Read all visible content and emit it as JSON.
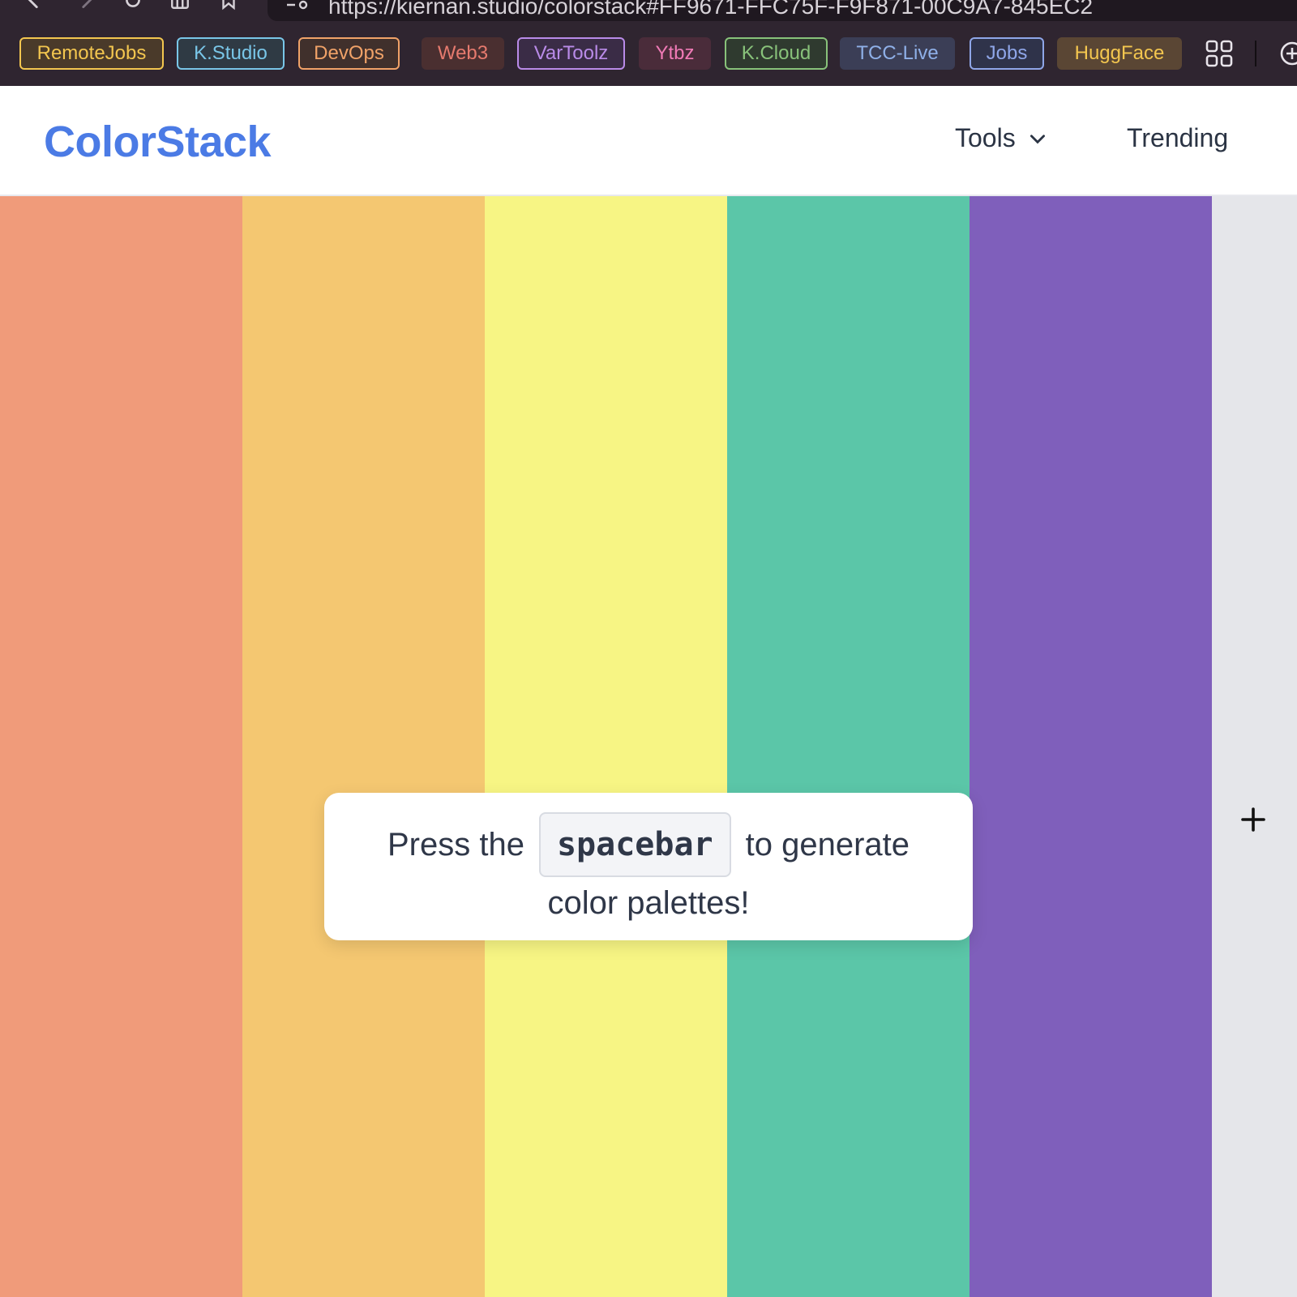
{
  "browser": {
    "url": "https://kiernan.studio/colorstack#FF9671-FFC75F-F9F871-00C9A7-845EC2",
    "bookmarks": [
      {
        "label": "RemoteJobs",
        "color": "#f3c64f",
        "bg": "#4a3a2a"
      },
      {
        "label": "K.Studio",
        "color": "#79c6e8",
        "bg": "#2f3a44"
      },
      {
        "label": "DevOps",
        "color": "#f0a268",
        "bg": "#40302c"
      },
      {
        "label": "Web3",
        "color": "#e57a6e",
        "bg": "#4a2f30"
      },
      {
        "label": "VarToolz",
        "color": "#b98be8",
        "bg": "#3a2c46"
      },
      {
        "label": "Ytbz",
        "color": "#f07ab6",
        "bg": "#4a2c3a"
      },
      {
        "label": "K.Cloud",
        "color": "#88c27a",
        "bg": "#2f3a2f"
      },
      {
        "label": "TCC-Live",
        "color": "#8fb0e8",
        "bg": "#3b3e56"
      },
      {
        "label": "Jobs",
        "color": "#8fa6e8",
        "bg": "#2f334a"
      },
      {
        "label": "HuggFace",
        "color": "#f3c64f",
        "bg": "#5a4634"
      }
    ]
  },
  "header": {
    "brand": "ColorStack",
    "nav_tools": "Tools",
    "nav_trending": "Trending"
  },
  "palette": {
    "swatches": [
      "#f09b7a",
      "#f4c771",
      "#f7f584",
      "#5bc6a8",
      "#7f5fbb"
    ],
    "add_column_bg": "#e5e6ea"
  },
  "hint": {
    "prefix": "Press the",
    "key": "spacebar",
    "suffix": "to generate",
    "line2": "color palettes!"
  },
  "colors": {
    "brand": "#4b7be5",
    "chrome": "#2f2530"
  }
}
